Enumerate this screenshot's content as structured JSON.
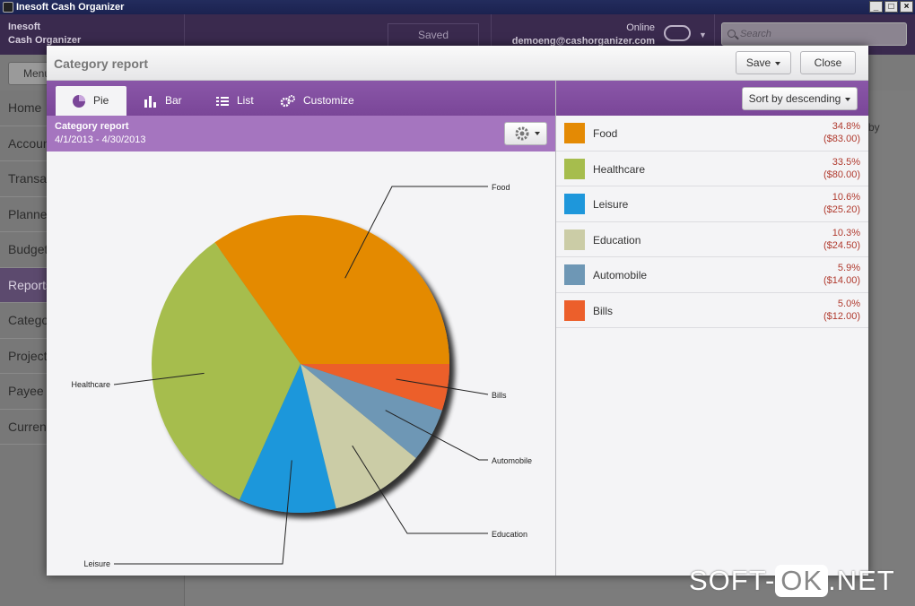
{
  "window": {
    "title": "Inesoft Cash Organizer"
  },
  "header": {
    "brand_line1": "Inesoft",
    "brand_line2": "Cash Organizer",
    "saved_label": "Saved",
    "online_label": "Online",
    "email": "demoeng@cashorganizer.com",
    "search_placeholder": "Search"
  },
  "menu_label": "Menu",
  "sidebar": {
    "items": [
      {
        "label": "Home"
      },
      {
        "label": "Accounts"
      },
      {
        "label": "Transactions"
      },
      {
        "label": "Planner"
      },
      {
        "label": "Budget"
      },
      {
        "label": "Reports"
      },
      {
        "label": "Categories"
      },
      {
        "label": "Projects"
      },
      {
        "label": "Payee"
      },
      {
        "label": "Currencies"
      }
    ],
    "active_index": 5
  },
  "background_text": "by",
  "modal": {
    "title": "Category report",
    "save_label": "Save",
    "close_label": "Close",
    "tabs": [
      {
        "label": "Pie",
        "icon": "pie-icon"
      },
      {
        "label": "Bar",
        "icon": "bar-icon"
      },
      {
        "label": "List",
        "icon": "list-icon"
      },
      {
        "label": "Customize",
        "icon": "gears-icon"
      }
    ],
    "sort_label": "Sort by descending",
    "report_title": "Category report",
    "date_range": "4/1/2013 - 4/30/2013"
  },
  "chart_data": {
    "type": "pie",
    "categories": [
      "Food",
      "Healthcare",
      "Leisure",
      "Education",
      "Automobile",
      "Bills"
    ],
    "values": [
      83.0,
      80.0,
      25.2,
      24.5,
      14.0,
      12.0
    ],
    "percents": [
      "34.8%",
      "33.5%",
      "10.6%",
      "10.3%",
      "5.9%",
      "5.0%"
    ],
    "amounts": [
      "($83.00)",
      "($80.00)",
      "($25.20)",
      "($24.50)",
      "($14.00)",
      "($12.00)"
    ],
    "colors": [
      "#e48a04",
      "#a6bd4d",
      "#1e97db",
      "#cbcca6",
      "#6e97b5",
      "#ec5f2b"
    ],
    "legend": "right"
  },
  "watermark": {
    "part1": "SOFT-",
    "part2": "OK",
    "part3": ".NET"
  }
}
